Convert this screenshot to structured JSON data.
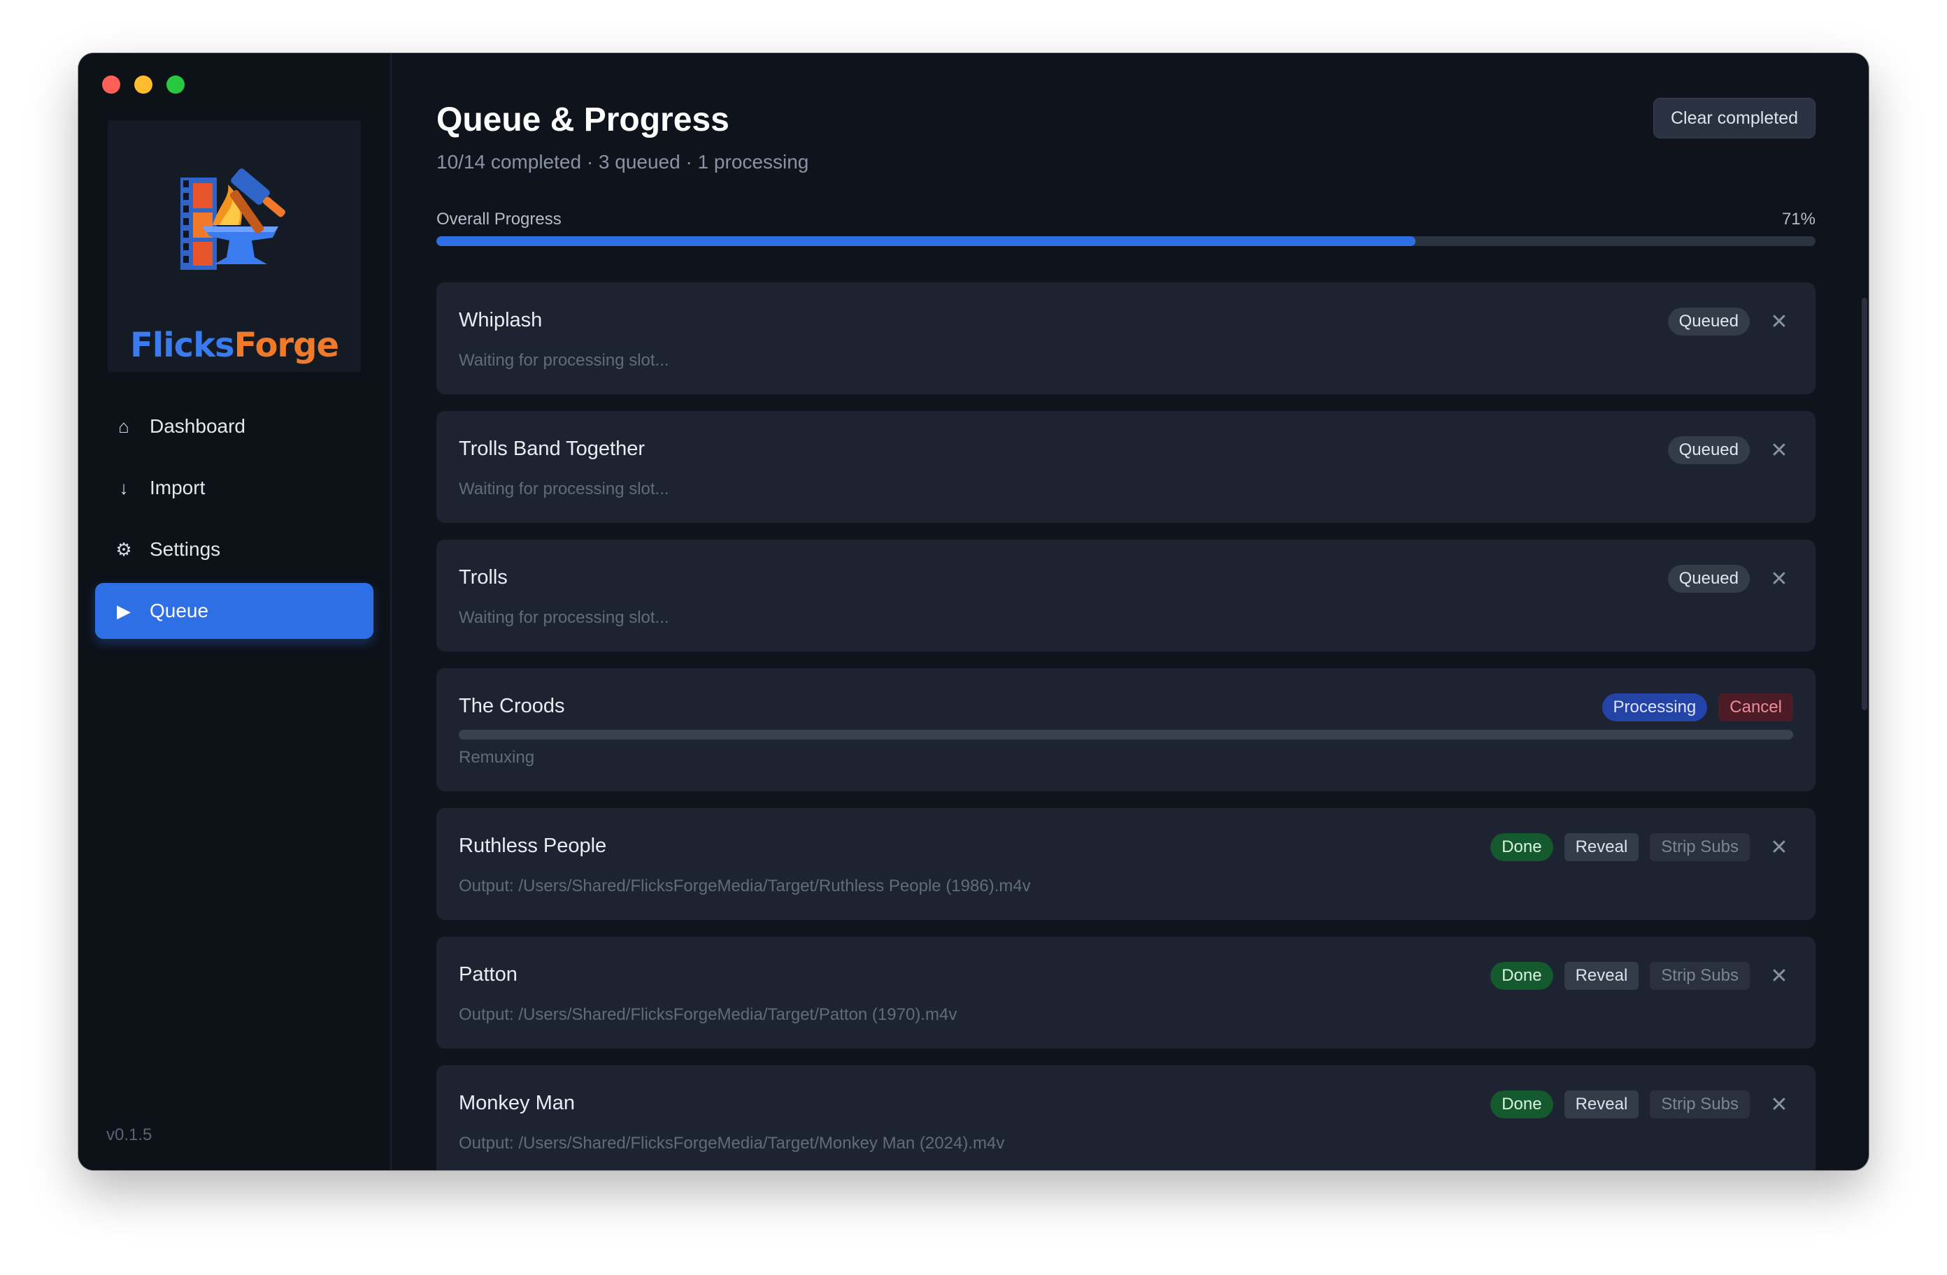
{
  "window": {
    "version": "v0.1.5"
  },
  "logo": {
    "word_a": "Flicks",
    "word_b": "Forge"
  },
  "sidebar": {
    "items": [
      {
        "label": "Dashboard",
        "icon": "home-icon",
        "active": false
      },
      {
        "label": "Import",
        "icon": "arrow-down-icon",
        "active": false
      },
      {
        "label": "Settings",
        "icon": "gear-icon",
        "active": false
      },
      {
        "label": "Queue",
        "icon": "play-icon",
        "active": true
      }
    ]
  },
  "header": {
    "title": "Queue & Progress",
    "subtitle": "10/14 completed · 3 queued · 1 processing",
    "clear_label": "Clear completed"
  },
  "overall": {
    "label": "Overall Progress",
    "percent_label": "71%",
    "percent": 71
  },
  "queue": [
    {
      "title": "Whiplash",
      "status": "Queued",
      "sub": "Waiting for processing slot..."
    },
    {
      "title": "Trolls Band Together",
      "status": "Queued",
      "sub": "Waiting for processing slot..."
    },
    {
      "title": "Trolls",
      "status": "Queued",
      "sub": "Waiting for processing slot..."
    },
    {
      "title": "The Croods",
      "status": "Processing",
      "sub": "Remuxing",
      "cancel_label": "Cancel",
      "progress": 0
    },
    {
      "title": "Ruthless People",
      "status": "Done",
      "sub": "Output: /Users/Shared/FlicksForgeMedia/Target/Ruthless People (1986).m4v",
      "reveal_label": "Reveal",
      "strip_label": "Strip Subs"
    },
    {
      "title": "Patton",
      "status": "Done",
      "sub": "Output: /Users/Shared/FlicksForgeMedia/Target/Patton (1970).m4v",
      "reveal_label": "Reveal",
      "strip_label": "Strip Subs"
    },
    {
      "title": "Monkey Man",
      "status": "Done",
      "sub": "Output: /Users/Shared/FlicksForgeMedia/Target/Monkey Man (2024).m4v",
      "reveal_label": "Reveal",
      "strip_label": "Strip Subs"
    }
  ],
  "colors": {
    "accent": "#2f6fe6",
    "done": "#155a2f",
    "processing": "#2443a6",
    "cancel": "#4b1c25"
  }
}
